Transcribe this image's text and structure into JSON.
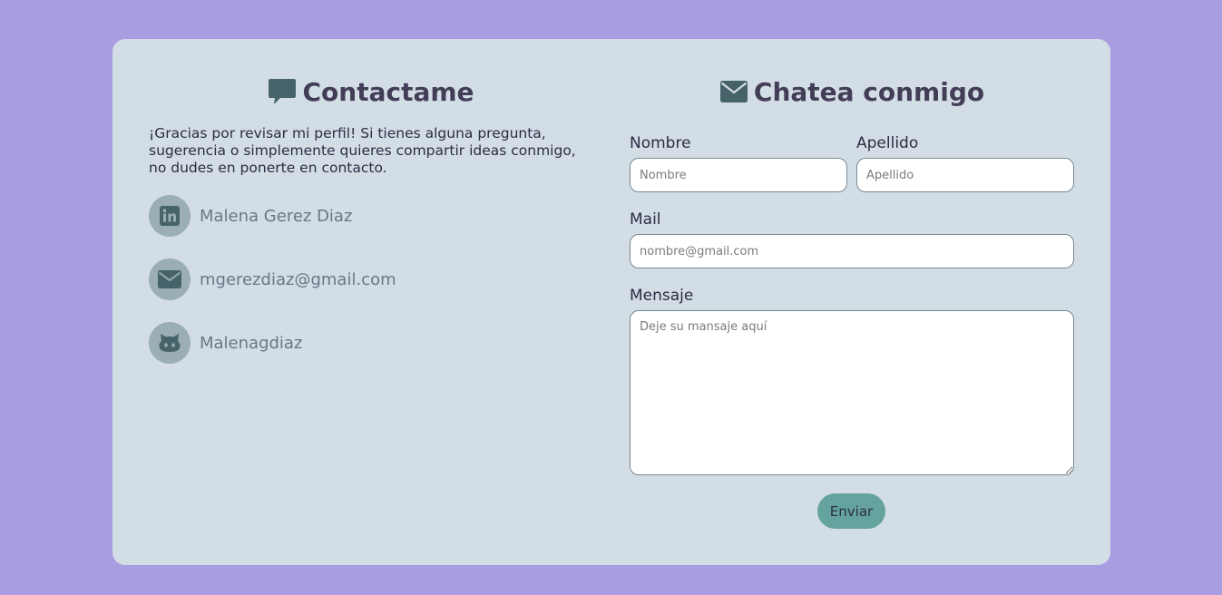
{
  "colors": {
    "page_background": "#a89de0",
    "card_background": "#d3dde6",
    "heading_text": "#433e57",
    "icon_dark": "#46636a",
    "icon_circle": "#9aaeb3",
    "button": "#65a39e"
  },
  "contact": {
    "title": "Contactame",
    "title_icon": "comment-icon",
    "intro": "¡Gracias por revisar mi perfil! Si tienes alguna pregunta, sugerencia o simplemente quieres compartir ideas conmigo, no dudes en ponerte en contacto.",
    "items": [
      {
        "icon": "linkedin-icon",
        "text": "Malena Gerez Diaz"
      },
      {
        "icon": "envelope-icon",
        "text": "mgerezdiaz@gmail.com"
      },
      {
        "icon": "github-icon",
        "text": "Malenagdiaz"
      }
    ]
  },
  "chat": {
    "title": "Chatea conmigo",
    "title_icon": "envelope-icon",
    "fields": {
      "nombre": {
        "label": "Nombre",
        "placeholder": "Nombre",
        "value": ""
      },
      "apellido": {
        "label": "Apellido",
        "placeholder": "Apellido",
        "value": ""
      },
      "mail": {
        "label": "Mail",
        "placeholder": "nombre@gmail.com",
        "value": ""
      },
      "mensaje": {
        "label": "Mensaje",
        "placeholder": "Deje su mansaje aquí",
        "value": ""
      }
    },
    "submit_label": "Enviar"
  }
}
